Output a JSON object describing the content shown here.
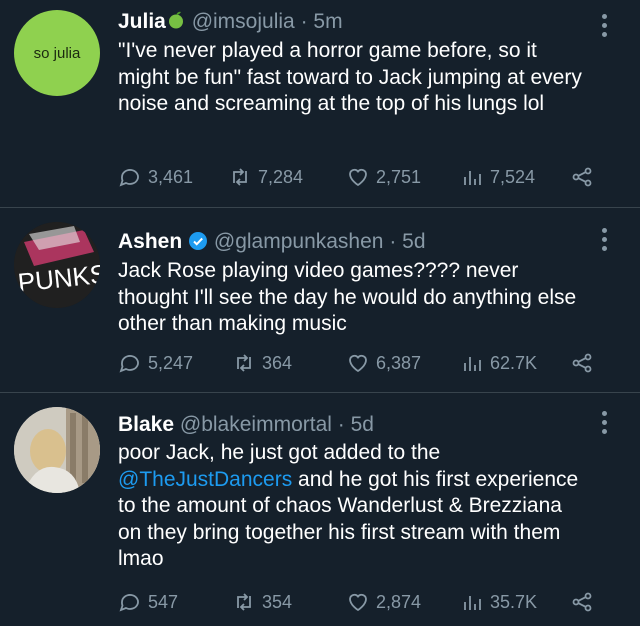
{
  "tweets": [
    {
      "avatar_text": "so julia",
      "name": "Julia",
      "name_emoji": "apple-emoji",
      "handle": "@imsojulia",
      "separator": "·",
      "time": "5m",
      "text_parts": [
        "\"I've never played a horror game before, so it might be fun\" fast toward to Jack jumping at every noise and screaming at the top of his lungs lol"
      ],
      "replies": "3,461",
      "retweets": "7,284",
      "likes": "2,751",
      "views": "7,524"
    },
    {
      "avatar_text": "PUNKS",
      "name": "Ashen",
      "verified": true,
      "handle": "@glampunkashen",
      "separator": "·",
      "time": "5d",
      "text_parts": [
        "Jack Rose playing video games???? never thought I'll see the day he would do anything else other than making music"
      ],
      "replies": "5,247",
      "retweets": "364",
      "likes": "6,387",
      "views": "62.7K"
    },
    {
      "name": "Blake",
      "handle": "@blakeimmortal",
      "separator": "·",
      "time": "5d",
      "text_before": "poor Jack, he just got added to the ",
      "mention": "@TheJustDancers",
      "text_after": " and he got his first experience to the amount of chaos Wanderlust & Brezziana on they bring together his first stream with them lmao",
      "replies": "547",
      "retweets": "354",
      "likes": "2,874",
      "views": "35.7K"
    }
  ],
  "colors": {
    "background": "#15202b",
    "text": "#ffffff",
    "muted": "#8899a6",
    "link": "#1d9bf0",
    "verified": "#1d9bf0",
    "divider": "#38444d"
  }
}
